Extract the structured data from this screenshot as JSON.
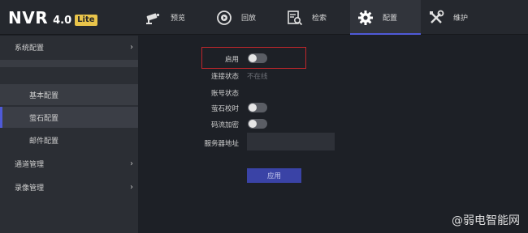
{
  "logo": {
    "product": "NVR",
    "version": "4.0",
    "edition": "Lite"
  },
  "nav": [
    {
      "label": "预览",
      "icon": "camera-icon"
    },
    {
      "label": "回放",
      "icon": "playback-icon"
    },
    {
      "label": "检索",
      "icon": "search-icon"
    },
    {
      "label": "配置",
      "icon": "gear-icon",
      "active": true
    },
    {
      "label": "维护",
      "icon": "tools-icon"
    }
  ],
  "sidebar": {
    "system_config": "系统配置",
    "basic_config": "基本配置",
    "ezviz_config": "萤石配置",
    "email_config": "邮件配置",
    "channel_mgmt": "通道管理",
    "record_mgmt": "录像管理"
  },
  "form": {
    "enable_label": "启用",
    "connection_status_label": "连接状态",
    "connection_status_value": "不在线",
    "account_status_label": "账号状态",
    "ezviz_time_sync_label": "萤石校时",
    "stream_encryption_label": "码流加密",
    "server_address_label": "服务器地址",
    "server_address_value": "",
    "apply_label": "应用"
  },
  "watermark": "@弱电智能网",
  "colors": {
    "accent": "#4f5ad8",
    "highlight_border": "#c0262b",
    "logo_badge": "#e9c44a"
  }
}
